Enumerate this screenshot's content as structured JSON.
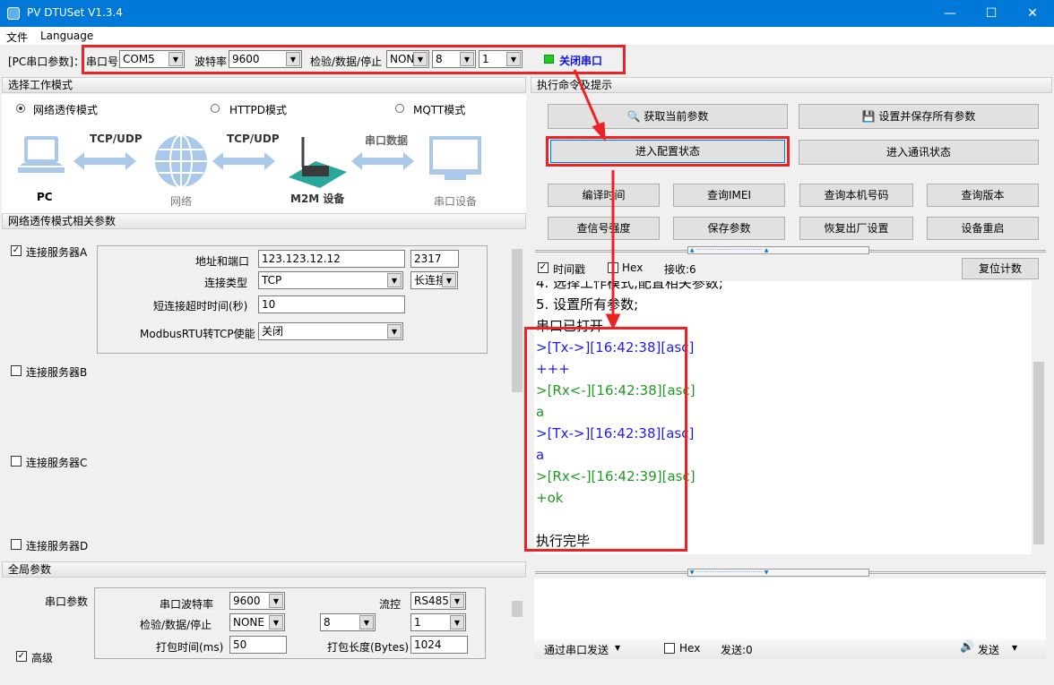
{
  "window": {
    "title": "PV DTUSet V1.3.4",
    "minimize": "—",
    "maximize": "☐",
    "close": "✕"
  },
  "menu": [
    "文件",
    "Language"
  ],
  "toolbar": {
    "label": "[PC串口参数]：",
    "port_label": "串口号",
    "port": "COM5",
    "baud_label": "波特率",
    "baud": "9600",
    "parity_label": "检验/数据/停止",
    "parity": "NONI",
    "databits": "8",
    "stopbits": "1",
    "close_port": "关闭串口",
    "led_color": "#22cc22"
  },
  "mode": {
    "header": "选择工作模式",
    "options": [
      {
        "label": "网络透传模式",
        "selected": true
      },
      {
        "label": "HTTPD模式",
        "selected": false
      },
      {
        "label": "MQTT模式",
        "selected": false
      }
    ],
    "diagram": {
      "pc": "PC",
      "link1": "TCP/UDP",
      "net": "网络",
      "link2": "TCP/UDP",
      "m2m": "M2M 设备",
      "link3": "串口数据",
      "serial": "串口设备"
    }
  },
  "net_params": {
    "header": "网络透传模式相关参数",
    "serverA": {
      "label": "连接服务器A",
      "checked": true,
      "addr_label": "地址和端口",
      "addr": "123.123.12.12",
      "port": "2317",
      "type_label": "连接类型",
      "type": "TCP",
      "conn_mode": "长连接",
      "timeout_label": "短连接超时时间(秒)",
      "timeout": "10",
      "modbus_label": "ModbusRTU转TCP使能",
      "modbus": "关闭"
    },
    "serverB": {
      "label": "连接服务器B",
      "checked": false
    },
    "serverC": {
      "label": "连接服务器C",
      "checked": false
    },
    "serverD": {
      "label": "连接服务器D",
      "checked": false
    }
  },
  "global": {
    "header": "全局参数",
    "serial_label": "串口参数",
    "baud_label": "串口波特率",
    "baud": "9600",
    "flow_label": "流控",
    "flow": "RS485",
    "parity_label": "检验/数据/停止",
    "parity": "NONE",
    "databits": "8",
    "stopbits": "1",
    "pack_time_label": "打包时间(ms)",
    "pack_time": "50",
    "pack_len_label": "打包长度(Bytes)",
    "pack_len": "1024",
    "advanced_label": "高级",
    "advanced": true
  },
  "commands": {
    "header": "执行命令及提示",
    "get_params": "获取当前参数",
    "save_all": "设置并保存所有参数",
    "enter_config": "进入配置状态",
    "enter_comm": "进入通讯状态",
    "row1": [
      "编译时间",
      "查询IMEI",
      "查询本机号码",
      "查询版本"
    ],
    "row2": [
      "查信号强度",
      "保存参数",
      "恢复出厂设置",
      "设备重启"
    ]
  },
  "log_bar": {
    "timestamp_label": "时间戳",
    "timestamp": true,
    "hex_label": "Hex",
    "hex": false,
    "recv": "接收:6",
    "reset": "复位计数"
  },
  "log": [
    {
      "text": "4. 选择工作模式,配置相关参数;",
      "kind": "plain"
    },
    {
      "text": "5. 设置所有参数;",
      "kind": "plain"
    },
    {
      "text": "串口已打开",
      "kind": "plain"
    },
    {
      "text": ">[Tx->][16:42:38][asc]",
      "kind": "tx"
    },
    {
      "text": "+++",
      "kind": "tx"
    },
    {
      "text": ">[Rx<-][16:42:38][asc]",
      "kind": "rx"
    },
    {
      "text": "a",
      "kind": "rx"
    },
    {
      "text": ">[Tx->][16:42:38][asc]",
      "kind": "tx"
    },
    {
      "text": "a",
      "kind": "tx"
    },
    {
      "text": ">[Rx<-][16:42:39][asc]",
      "kind": "rx"
    },
    {
      "text": "+ok",
      "kind": "rx"
    },
    {
      "text": "",
      "kind": "plain"
    },
    {
      "text": "执行完毕",
      "kind": "plain"
    }
  ],
  "send_bar": {
    "via": "通过串口发送",
    "hex_label": "Hex",
    "hex": false,
    "sent": "发送:0",
    "send": "发送"
  },
  "annotation_color": "#ee2222"
}
